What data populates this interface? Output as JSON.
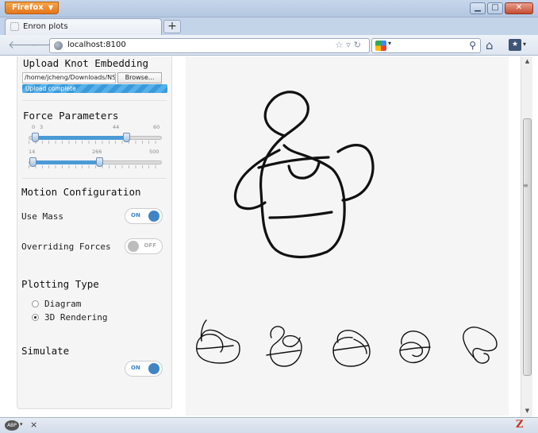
{
  "browser": {
    "app_button": "Firefox",
    "tab_title": "Enron plots",
    "url": "localhost:8100"
  },
  "upload": {
    "title": "Upload Knot Embedding",
    "file_path": "/home/jcheng/Downloads/NST_I",
    "browse_label": "Browse...",
    "status": "Upload complete",
    "progress": 1.0
  },
  "force": {
    "title": "Force Parameters",
    "slider1": {
      "min": 0,
      "max": 60,
      "range": [
        3,
        44
      ],
      "labels": [
        "0",
        "3",
        "44",
        "60"
      ]
    },
    "slider2": {
      "min": 0,
      "max": 500,
      "range": [
        14,
        266
      ],
      "labels": [
        "14",
        "266",
        "500"
      ]
    }
  },
  "motion": {
    "title": "Motion Configuration",
    "use_mass_label": "Use Mass",
    "use_mass_state": "ON",
    "overriding_label": "Overriding Forces",
    "overriding_state": "OFF"
  },
  "plotting": {
    "title": "Plotting Type",
    "options": [
      "Diagram",
      "3D Rendering"
    ],
    "selected": "3D Rendering"
  },
  "simulate": {
    "title": "Simulate",
    "state": "ON"
  },
  "icons": {
    "app": "firefox-logo",
    "nav_back": "arrow-left-icon",
    "nav_forward": "arrow-right-icon",
    "home": "home-icon",
    "search": "magnifier-icon",
    "status_right": "zotero-icon"
  },
  "colors": {
    "accent": "#3f85c5",
    "firefox_orange": "#e4761c",
    "plot_bg": "#f5f5f5"
  }
}
